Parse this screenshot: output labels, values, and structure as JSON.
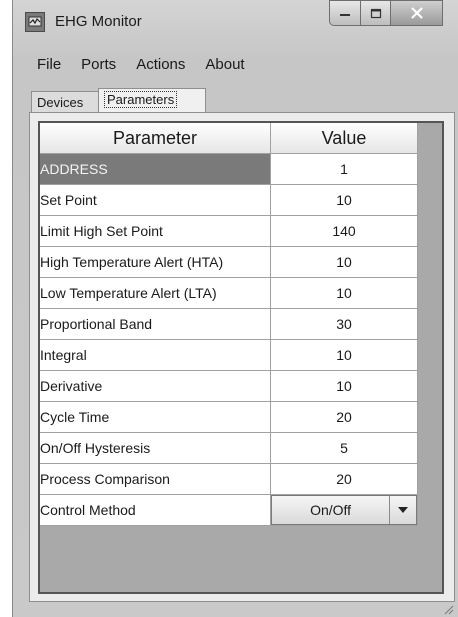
{
  "window": {
    "title": "EHG Monitor",
    "icon": "monitor-app-icon"
  },
  "menu": [
    "File",
    "Ports",
    "Actions",
    "About"
  ],
  "tabs": {
    "devices": "Devices",
    "parameters": "Parameters",
    "active": "Parameters"
  },
  "table": {
    "headers": {
      "parameter": "Parameter",
      "value": "Value"
    },
    "rows": [
      {
        "name": "ADDRESS",
        "value": "1",
        "selected": true
      },
      {
        "name": "Set Point",
        "value": "10"
      },
      {
        "name": "Limit High Set Point",
        "value": "140"
      },
      {
        "name": "High Temperature Alert (HTA)",
        "value": "10"
      },
      {
        "name": "Low Temperature Alert (LTA)",
        "value": "10"
      },
      {
        "name": "Proportional Band",
        "value": "30"
      },
      {
        "name": "Integral",
        "value": "10"
      },
      {
        "name": "Derivative",
        "value": "10"
      },
      {
        "name": "Cycle Time",
        "value": "20"
      },
      {
        "name": "On/Off Hysteresis",
        "value": "5"
      },
      {
        "name": "Process Comparison",
        "value": "20"
      }
    ],
    "control_method": {
      "name": "Control Method",
      "value": "On/Off"
    }
  },
  "colors": {
    "selected_row": "#7a7a7a",
    "window_chrome": "#c9c9c9"
  }
}
